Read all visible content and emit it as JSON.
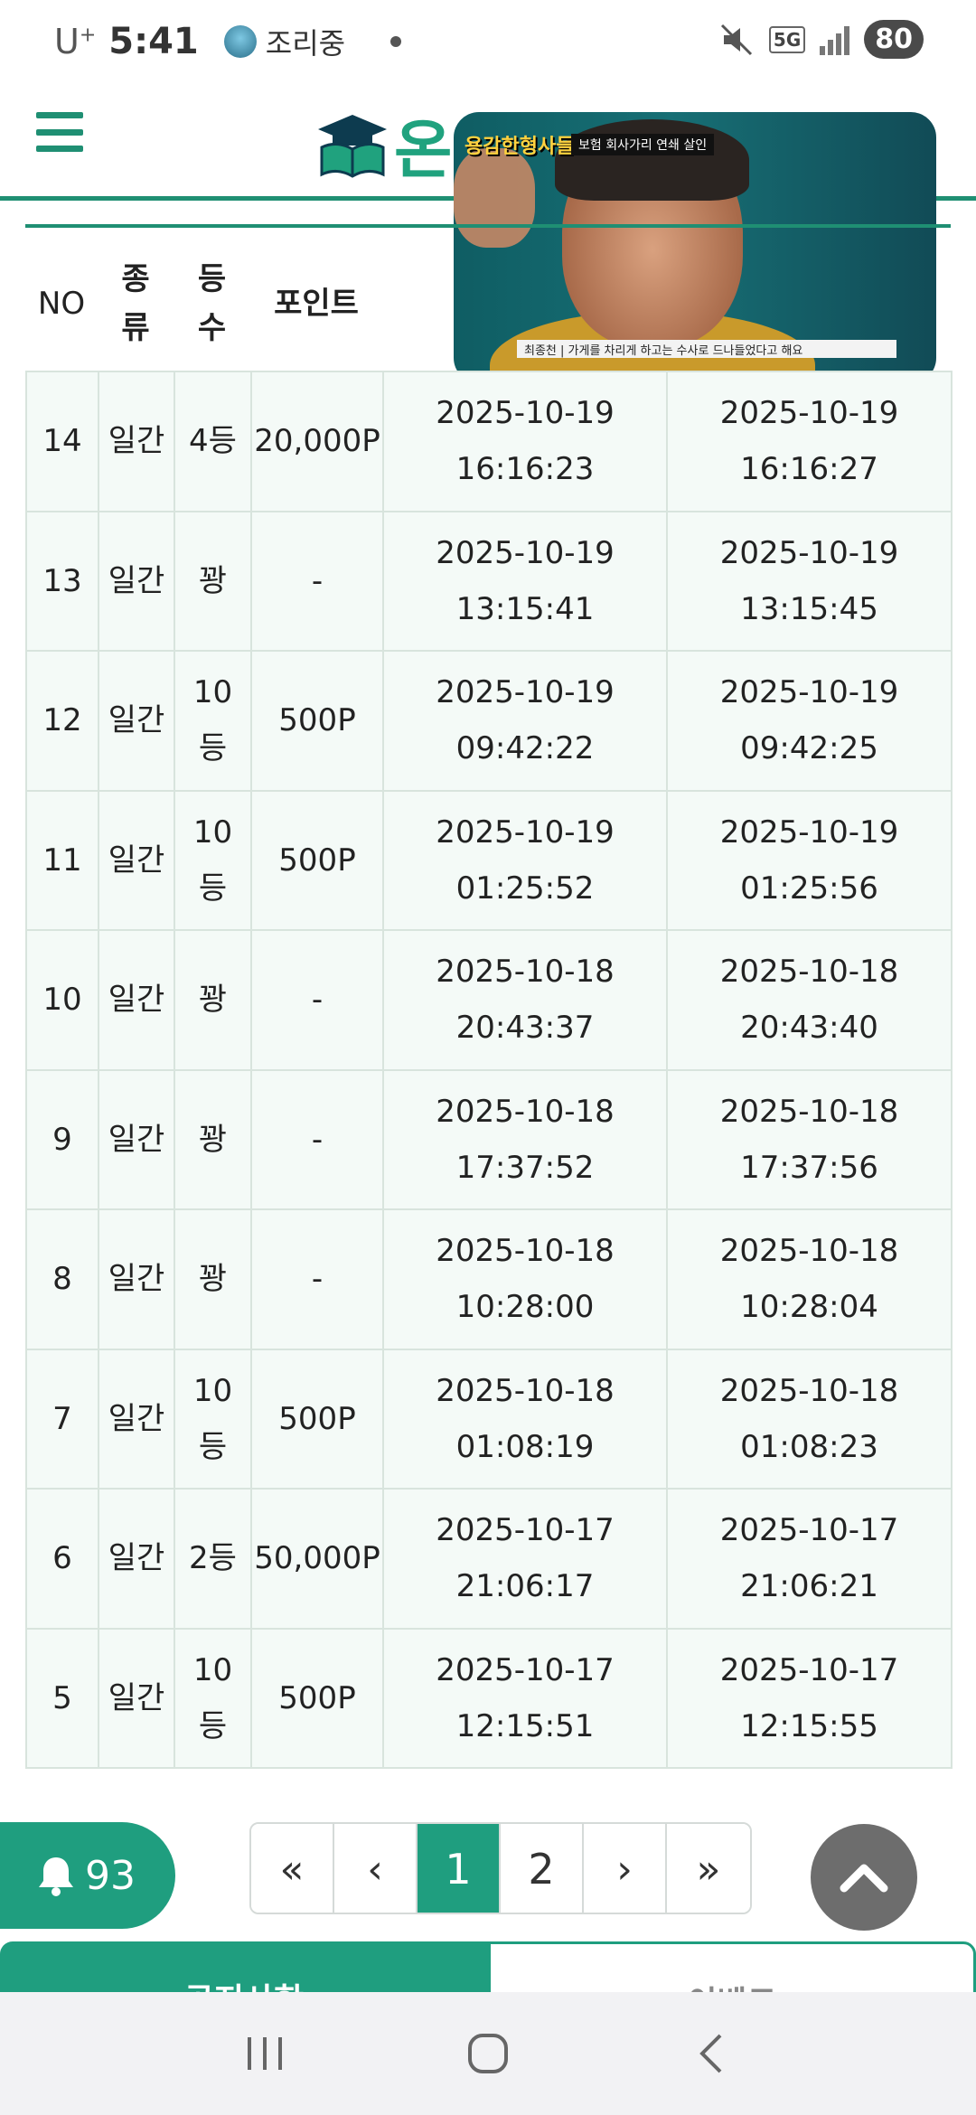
{
  "status_bar": {
    "carrier": "U",
    "carrier_sup": "+",
    "time": "5:41",
    "notification": "조리중",
    "network": "5G",
    "battery": "80"
  },
  "header": {
    "logo_text": "온"
  },
  "pip": {
    "show_title": "용감한형사들2",
    "tag": "보험 회사가리 연쇄 살인",
    "subtitle": "최종천 | 가게를 차리게 하고는 수사로 드나들었다고 해요"
  },
  "table": {
    "headers": {
      "no": "NO",
      "type": "종류",
      "rank": "등수",
      "point": "포인트"
    },
    "rows": [
      {
        "no": "14",
        "type": "일간",
        "rank": "4등",
        "point": "20,000P",
        "t1_date": "2025-10-19",
        "t1_time": "16:16:23",
        "t2_date": "2025-10-19",
        "t2_time": "16:16:27"
      },
      {
        "no": "13",
        "type": "일간",
        "rank": "꽝",
        "point": "-",
        "t1_date": "2025-10-19",
        "t1_time": "13:15:41",
        "t2_date": "2025-10-19",
        "t2_time": "13:15:45"
      },
      {
        "no": "12",
        "type": "일간",
        "rank": "10등",
        "point": "500P",
        "t1_date": "2025-10-19",
        "t1_time": "09:42:22",
        "t2_date": "2025-10-19",
        "t2_time": "09:42:25"
      },
      {
        "no": "11",
        "type": "일간",
        "rank": "10등",
        "point": "500P",
        "t1_date": "2025-10-19",
        "t1_time": "01:25:52",
        "t2_date": "2025-10-19",
        "t2_time": "01:25:56"
      },
      {
        "no": "10",
        "type": "일간",
        "rank": "꽝",
        "point": "-",
        "t1_date": "2025-10-18",
        "t1_time": "20:43:37",
        "t2_date": "2025-10-18",
        "t2_time": "20:43:40"
      },
      {
        "no": "9",
        "type": "일간",
        "rank": "꽝",
        "point": "-",
        "t1_date": "2025-10-18",
        "t1_time": "17:37:52",
        "t2_date": "2025-10-18",
        "t2_time": "17:37:56"
      },
      {
        "no": "8",
        "type": "일간",
        "rank": "꽝",
        "point": "-",
        "t1_date": "2025-10-18",
        "t1_time": "10:28:00",
        "t2_date": "2025-10-18",
        "t2_time": "10:28:04"
      },
      {
        "no": "7",
        "type": "일간",
        "rank": "10등",
        "point": "500P",
        "t1_date": "2025-10-18",
        "t1_time": "01:08:19",
        "t2_date": "2025-10-18",
        "t2_time": "01:08:23"
      },
      {
        "no": "6",
        "type": "일간",
        "rank": "2등",
        "point": "50,000P",
        "t1_date": "2025-10-17",
        "t1_time": "21:06:17",
        "t2_date": "2025-10-17",
        "t2_time": "21:06:21"
      },
      {
        "no": "5",
        "type": "일간",
        "rank": "10등",
        "point": "500P",
        "t1_date": "2025-10-17",
        "t1_time": "12:15:51",
        "t2_date": "2025-10-17",
        "t2_time": "12:15:55"
      }
    ]
  },
  "notification_bell": {
    "count": "93"
  },
  "pagination": {
    "first": "«",
    "prev": "‹",
    "pages": [
      "1",
      "2"
    ],
    "current": "1",
    "next": "›",
    "last": "»"
  },
  "tabs": {
    "notice": "공지사항",
    "event": "이벤트"
  },
  "colors": {
    "accent": "#1f9e7f",
    "row_bg": "#f4faf7",
    "top_button": "#6d6d6d"
  }
}
